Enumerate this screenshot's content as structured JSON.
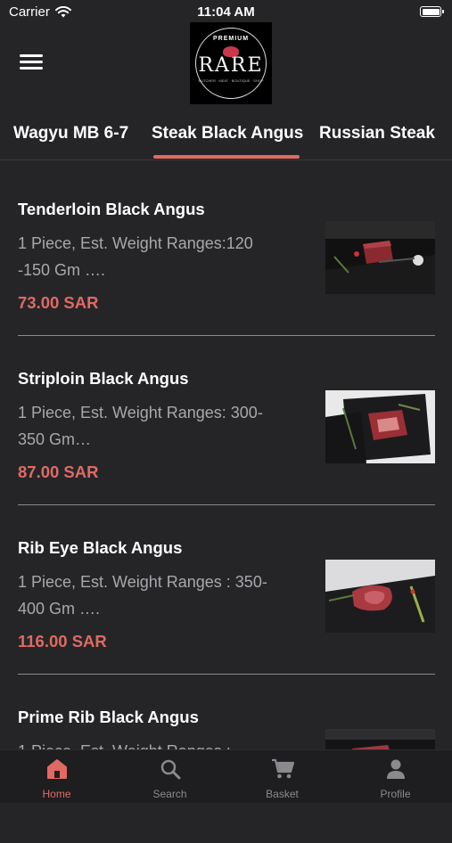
{
  "status_bar": {
    "carrier": "Carrier",
    "time": "11:04 AM"
  },
  "logo": {
    "premium": "PREMIUM",
    "brand": "RARE",
    "tagline": "BUTCHER · MEAT · BOUTIQUE · SHOP"
  },
  "tabs": [
    {
      "label": "Wagyu MB 6-7",
      "active": false
    },
    {
      "label": "Steak Black Angus",
      "active": true
    },
    {
      "label": "Russian Steak",
      "active": false
    }
  ],
  "products": [
    {
      "name": "Tenderloin Black Angus",
      "desc": "1 Piece, Est. Weight Ranges:120 -150 Gm ….",
      "price": "73.00 SAR"
    },
    {
      "name": "Striploin Black Angus",
      "desc": "1 Piece, Est. Weight Ranges: 300-350 Gm…",
      "price": "87.00 SAR"
    },
    {
      "name": "Rib Eye Black Angus",
      "desc": "1 Piece, Est. Weight Ranges : 350-400 Gm ….",
      "price": "116.00 SAR"
    },
    {
      "name": "Prime Rib Black Angus",
      "desc": "1 Piece, Est. Weight Ranges :",
      "price": ""
    }
  ],
  "tabbar": [
    {
      "label": "Home",
      "icon": "home-icon",
      "active": true
    },
    {
      "label": "Search",
      "icon": "search-icon",
      "active": false
    },
    {
      "label": "Basket",
      "icon": "cart-icon",
      "active": false
    },
    {
      "label": "Profile",
      "icon": "person-icon",
      "active": false
    }
  ],
  "colors": {
    "accent": "#e06a62",
    "background": "#252528",
    "tabbar": "#1e1e21"
  }
}
